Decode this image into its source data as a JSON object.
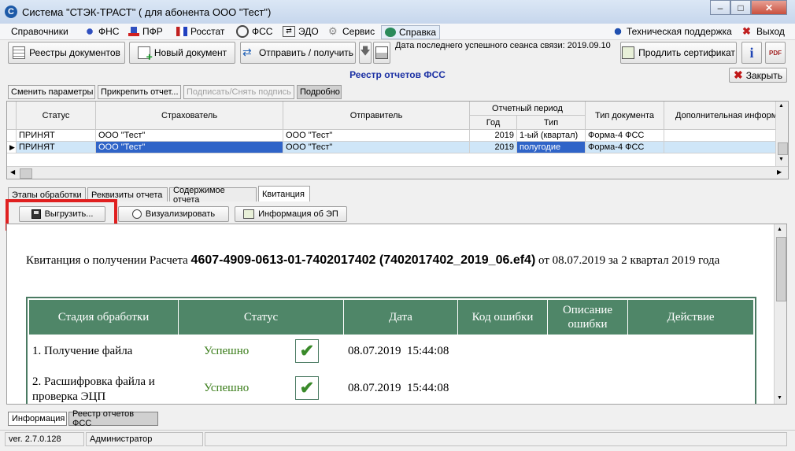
{
  "window": {
    "title": "Система \"СТЭК-ТРАСТ\" ( для абонента ООО \"Тест\")",
    "logo_letter": "С",
    "minimize": "–",
    "maximize": "□",
    "close": "✕"
  },
  "menu": {
    "items": [
      "Справочники",
      "ФНС",
      "ПФР",
      "Росстат",
      "ФСС",
      "ЭДО",
      "Сервис",
      "Справка"
    ],
    "support": "Техническая поддержка",
    "exit": "Выход"
  },
  "toolbar": {
    "registry": "Реестры документов",
    "new_doc": "Новый документ",
    "send_receive": "Отправить / получить",
    "last_session": "Дата последнего успешного сеанса связи: 2019.09.10",
    "renew_cert": "Продлить сертификат",
    "info_glyph": "i",
    "pdf_glyph": "PDF"
  },
  "registry_title": "Реестр отчетов ФСС",
  "close_button": "Закрыть",
  "sub_buttons": {
    "change_params": "Сменить параметры",
    "attach_report": "Прикрепить отчет...",
    "sign": "Подписать/Снять подпись",
    "details": "Подробно"
  },
  "grid": {
    "headers": {
      "status": "Статус",
      "insurer": "Страхователь",
      "sender": "Отправитель",
      "period": "Отчетный период",
      "year": "Год",
      "type": "Тип",
      "doc_type": "Тип документа",
      "extra": "Дополнительная информ"
    },
    "rows": [
      {
        "status": "ПРИНЯТ",
        "insurer": "ООО \"Тест\"",
        "sender": "ООО \"Тест\"",
        "year": "2019",
        "type": "1-ый (квартал)",
        "doc_type": "Форма-4 ФСС"
      },
      {
        "status": "ПРИНЯТ",
        "insurer": "ООО \"Тест\"",
        "sender": "ООО \"Тест\"",
        "year": "2019",
        "type": "полугодие",
        "doc_type": "Форма-4 ФСС"
      }
    ]
  },
  "tabs": [
    "Этапы обработки",
    "Реквизиты отчета",
    "Содержимое отчета",
    "Квитанция"
  ],
  "actions": {
    "export": "Выгрузить...",
    "visualize": "Визуализировать",
    "ep_info": "Информация об ЭП"
  },
  "receipt": {
    "prefix": "Квитанция о получении Расчета",
    "number": "4607-4909-0613-01-7402017402 (7402017402_2019_06.ef4)",
    "suffix": "от 08.07.2019 за 2 квартал 2019 года",
    "columns": [
      "Стадия обработки",
      "Статус",
      "Дата",
      "Код ошибки",
      "Описание ошибки",
      "Действие"
    ],
    "rows": [
      {
        "stage": "1. Получение файла",
        "status": "Успешно",
        "date": "08.07.2019  15:44:08"
      },
      {
        "stage": "2. Расшифровка файла и проверка ЭЦП",
        "status": "Успешно",
        "date": "08.07.2019  15:44:08"
      }
    ],
    "check_glyph": "✔",
    "status_color": "#3a7d1a",
    "header_color": "#4f8668"
  },
  "bottom_tabs": [
    "Информация",
    "Реестр отчетов ФСС"
  ],
  "status": {
    "version": "ver. 2.7.0.128",
    "user": "Администратор"
  },
  "highlight_color": "#e02020"
}
